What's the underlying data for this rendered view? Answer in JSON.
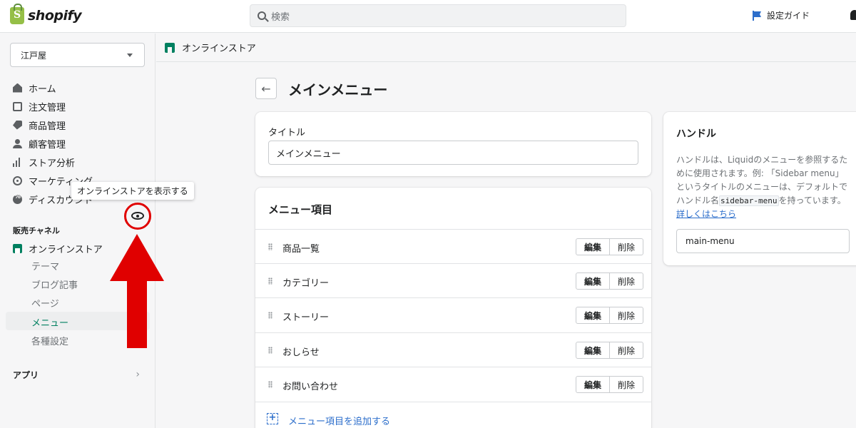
{
  "topbar": {
    "logo_text": "shopify",
    "logo_mark": "S",
    "search_placeholder": "検索",
    "setup_guide": "設定ガイド"
  },
  "sidebar": {
    "store_name": "江戸屋",
    "items": [
      {
        "label": "ホーム",
        "icon": "home-icon"
      },
      {
        "label": "注文管理",
        "icon": "orders-icon"
      },
      {
        "label": "商品管理",
        "icon": "tag-icon"
      },
      {
        "label": "顧客管理",
        "icon": "user-icon"
      },
      {
        "label": "ストア分析",
        "icon": "analytics-icon"
      },
      {
        "label": "マーケティング",
        "icon": "marketing-icon"
      },
      {
        "label": "ディスカウント",
        "icon": "discount-icon"
      }
    ],
    "sales_channels_label": "販売チャネル",
    "online_store": "オンラインストア",
    "online_store_tooltip": "オンラインストアを表示する",
    "sub_items": [
      "テーマ",
      "ブログ記事",
      "ページ",
      "メニュー",
      "各種設定"
    ],
    "active_sub_item": "メニュー",
    "apps_label": "アプリ"
  },
  "breadcrumb": {
    "label": "オンラインストア"
  },
  "page": {
    "title": "メインメニュー",
    "back_icon": "←"
  },
  "title_card": {
    "label": "タイトル",
    "value": "メインメニュー"
  },
  "menu_card": {
    "heading": "メニュー項目",
    "edit_label": "編集",
    "delete_label": "削除",
    "items": [
      "商品一覧",
      "カテゴリー",
      "ストーリー",
      "おしらせ",
      "お問い合わせ"
    ],
    "add_label": "メニュー項目を追加する"
  },
  "handle_card": {
    "heading": "ハンドル",
    "desc_1": "ハンドルは、Liquidのメニューを参照するために使用されます。例: 「Sidebar menu」というタイトルのメニューは、デフォルトでハンドル名",
    "code": "sidebar-menu",
    "desc_2": "を持っています。",
    "link": "詳しくはこちら",
    "value": "main-menu"
  },
  "colors": {
    "accent": "#008060",
    "link": "#2c6ecb",
    "annotation": "#e00000"
  }
}
